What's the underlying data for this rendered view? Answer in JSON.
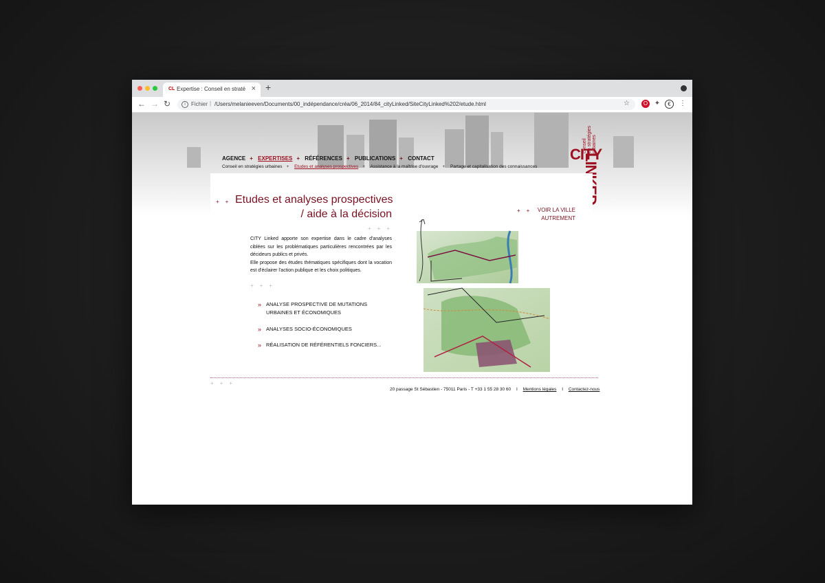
{
  "browser": {
    "tab_title": "Expertise : Conseil en stratégie",
    "tab_favicon": "CL",
    "url_scheme": "Fichier",
    "url": "/Users/melanieeven/Documents/00_indépendance/créa/06_2014/84_cityLinked/SiteCityLinked%202/etude.html"
  },
  "nav": {
    "items": [
      {
        "label": "AGENCE"
      },
      {
        "label": "EXPERTISES"
      },
      {
        "label": "RÉFÉRENCES"
      },
      {
        "label": "PUBLICATIONS"
      },
      {
        "label": "CONTACT"
      }
    ],
    "sub": [
      {
        "label": "Conseil en stratégies urbaines"
      },
      {
        "label": "Etudes et analyses prospectives"
      },
      {
        "label": "Assistance à la maîtrise d'ouvrage"
      },
      {
        "label": "Partage et capitalisation des connaissances"
      }
    ],
    "separator": "+"
  },
  "logo": {
    "city": "CITY",
    "linked": "LINKED",
    "tagline": [
      "conseil",
      "en stratégies",
      "urbaines"
    ]
  },
  "content": {
    "title_line1": "Etudes et analyses prospectives",
    "title_line2": "/ aide à la décision",
    "para1": "CITY Linked apporte son expertise dans le cadre d'analyses ciblées sur les problématiques particulières rencontrées par les décideurs publics et privés.",
    "para2": "Elle propose des études thématiques spécifiques dont la vocation est d'éclairer l'action publique et les choix politiques.",
    "services": [
      "ANALYSE PROSPECTIVE DE MUTATIONS URBAINES ET ÉCONOMIQUES",
      "ANALYSES SOCIO-ÉCONOMIQUES",
      "RÉALISATION DE RÉFÉRENTIELS FONCIERS..."
    ],
    "voir_line1": "VOIR LA VILLE",
    "voir_line2": "AUTREMENT"
  },
  "footer": {
    "address": "20 passage St Sébastien - 75011 Paris - T +33 1 55 28 30 60",
    "legal": "Mentions légales",
    "contact": "Contactez-nous",
    "sep": "I"
  },
  "colors": {
    "brand": "#9c1020",
    "brand_dark": "#7a1020"
  }
}
